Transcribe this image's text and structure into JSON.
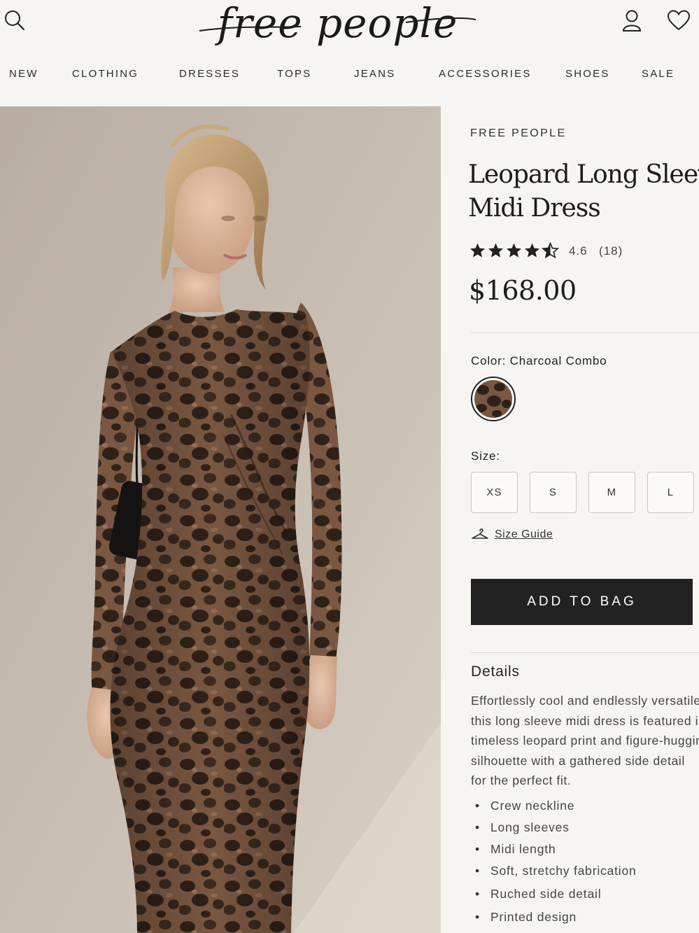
{
  "header": {
    "logo": "free people",
    "nav": [
      "NEW",
      "CLOTHING",
      "DRESSES",
      "TOPS",
      "JEANS",
      "ACCESSORIES",
      "SHOES",
      "SALE"
    ]
  },
  "product": {
    "brand": "FREE PEOPLE",
    "title_line1": "Leopard Long Sleeve",
    "title_line2": "Midi Dress",
    "rating": "4.6",
    "rating_value": 4.6,
    "reviews": "(18)",
    "price": "$168.00",
    "color_label": "Color: Charcoal Combo",
    "size_label": "Size:",
    "sizes": [
      "XS",
      "S",
      "M",
      "L"
    ],
    "size_guide": "Size Guide",
    "add_to_bag": "ADD TO BAG",
    "details_heading": "Details",
    "details_lines": [
      "Effortlessly cool and endlessly versatile,",
      "this long sleeve midi dress is featured in a",
      "timeless leopard print and figure-hugging",
      "silhouette with a gathered side detail",
      "for the perfect fit."
    ],
    "bullets": [
      "Crew neckline",
      "Long sleeves",
      "Midi length",
      "Soft, stretchy fabrication",
      "Ruched side detail",
      "Printed design"
    ]
  },
  "colors": {
    "background": "#f7f5f2",
    "button": "#222222",
    "print_base": "#7a5741",
    "print_spot": "#2e2119"
  },
  "icons": {
    "search": "search-icon",
    "account": "account-icon",
    "wishlist": "heart-icon",
    "star": "star-icon",
    "hanger": "hanger-icon"
  }
}
